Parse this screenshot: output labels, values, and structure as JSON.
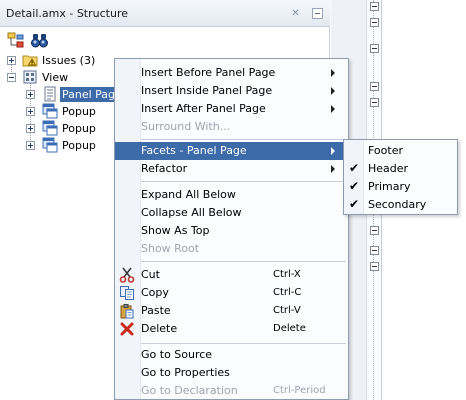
{
  "panel": {
    "title": "Detail.amx - Structure",
    "close_icon": "close-icon",
    "minimize_icon": "minimize-icon"
  },
  "toolbar": {
    "buttons": [
      {
        "icon": "structure-tree-icon"
      },
      {
        "icon": "binoculars-find-icon"
      }
    ]
  },
  "tree": {
    "nodes": [
      {
        "label": "Issues (3)",
        "icon": "folder-warning-icon",
        "expander": "plus"
      },
      {
        "label": "View",
        "icon": "view-grid-icon",
        "expander": "minus"
      },
      {
        "label": "Panel Page",
        "icon": "panel-page-icon",
        "expander": "plus",
        "selected": true
      },
      {
        "label": "Popup",
        "icon": "popup-icon",
        "expander": "plus"
      },
      {
        "label": "Popup",
        "icon": "popup-icon",
        "expander": "plus"
      },
      {
        "label": "Popup",
        "icon": "popup-icon",
        "expander": "plus"
      }
    ]
  },
  "context_menu": {
    "items": [
      {
        "label": "Insert Before Panel Page",
        "submenu": true
      },
      {
        "label": "Insert Inside Panel Page",
        "submenu": true
      },
      {
        "label": "Insert After Panel Page",
        "submenu": true
      },
      {
        "label": "Surround With...",
        "disabled": true
      },
      {
        "label": "Facets - Panel Page",
        "submenu": true,
        "highlighted": true
      },
      {
        "label": "Refactor",
        "submenu": true
      },
      {
        "label": "Expand All Below"
      },
      {
        "label": "Collapse All Below"
      },
      {
        "label": "Show As Top"
      },
      {
        "label": "Show Root",
        "disabled": true
      },
      {
        "label": "Cut",
        "accelerator": "Ctrl-X",
        "icon": "scissors-icon"
      },
      {
        "label": "Copy",
        "accelerator": "Ctrl-C",
        "icon": "copy-icon"
      },
      {
        "label": "Paste",
        "accelerator": "Ctrl-V",
        "icon": "paste-icon"
      },
      {
        "label": "Delete",
        "accelerator": "Delete",
        "icon": "delete-x-icon"
      },
      {
        "label": "Go to Source"
      },
      {
        "label": "Go to Properties"
      },
      {
        "label": "Go to Declaration",
        "accelerator": "Ctrl-Period",
        "disabled": true
      }
    ]
  },
  "facets_submenu": {
    "items": [
      {
        "label": "Footer",
        "checked": false
      },
      {
        "label": "Header",
        "checked": true
      },
      {
        "label": "Primary",
        "checked": true
      },
      {
        "label": "Secondary",
        "checked": true
      }
    ]
  },
  "colors": {
    "selection": "#3d6aa8",
    "disabled_text": "#9da4ae",
    "delete_icon": "#cc2a1c"
  }
}
